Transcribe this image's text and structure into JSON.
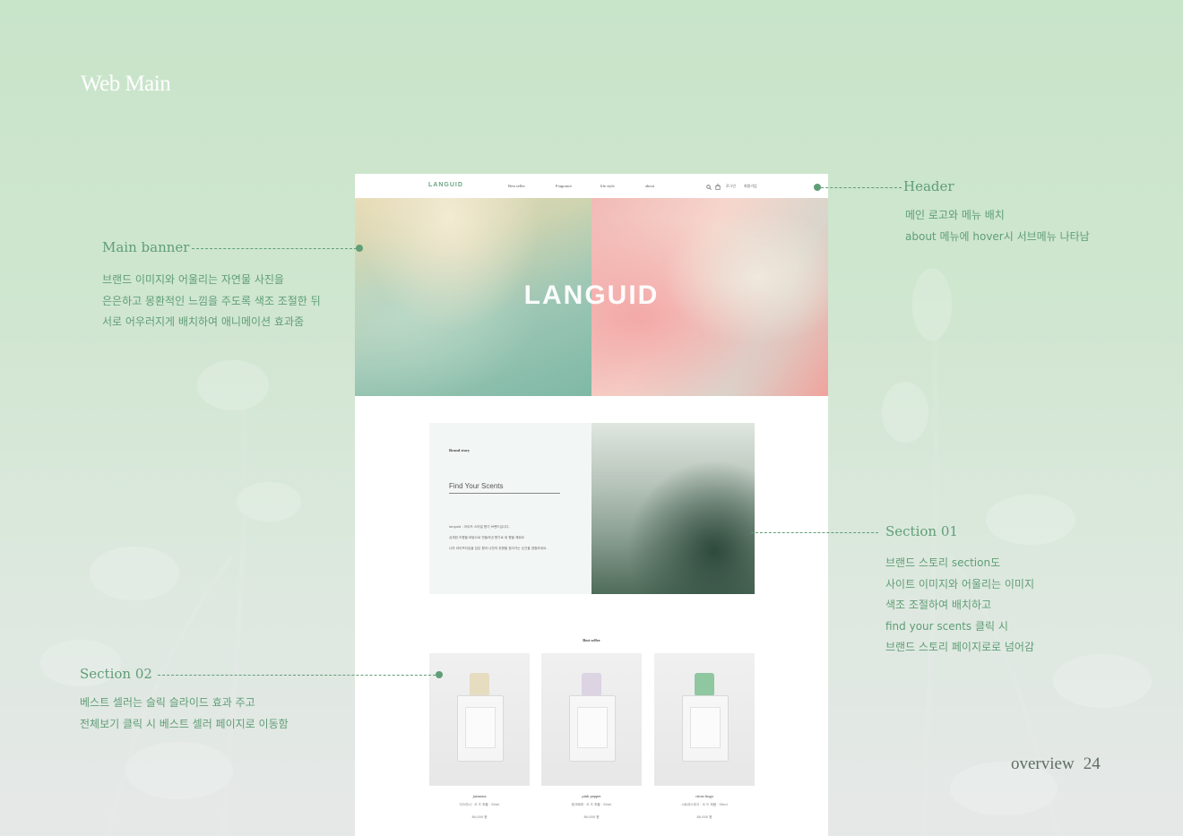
{
  "page": {
    "title": "Web Main",
    "footer_label": "overview",
    "footer_page": "24"
  },
  "annotations": {
    "header": {
      "title": "Header",
      "lines": [
        "메인 로고와 메뉴 배치",
        "about 메뉴에 hover시 서브메뉴 나타남"
      ]
    },
    "main_banner": {
      "title": "Main banner",
      "lines": [
        "브랜드 이미지와 어울리는 자연물 사진을",
        "은은하고 몽환적인 느낌을 주도록 색조 조절한 뒤",
        "서로 어우러지게 배치하여 애니메이션 효과줌"
      ]
    },
    "section01": {
      "title": "Section 01",
      "lines": [
        "브랜드 스토리 section도",
        "사이트 이미지와 어울리는 이미지",
        "색조 조절하여 배치하고",
        " find your scents 클릭 시",
        "브랜드 스토리 페이지로로 넘어감"
      ]
    },
    "section02": {
      "title": "Section 02",
      "lines": [
        "베스트 셀러는 슬릭 슬라이드 효과 주고",
        "전체보기 클릭 시 베스트 셀러 페이지로 이동함"
      ]
    }
  },
  "mock": {
    "header": {
      "logo": "LANGUID",
      "nav": [
        "Best seller",
        "Fragrance",
        "life style",
        "about"
      ],
      "util": [
        "로그인",
        "회원가입"
      ]
    },
    "banner": {
      "brand": "LANGUID"
    },
    "story": {
      "label": "Brand story",
      "cta": "Find Your Scents",
      "copy": [
        "languid : 아이즈 스타일 향기 브랜드입니다.",
        "섬세한 조향을 바탕으로 만들어낸 향기로 위 향을 채워요",
        "나의 라이프타입을 담은 향과 나만의 취향을 찾아가는 순간을 경험하세요."
      ]
    },
    "bestseller": {
      "title": "Best seller",
      "products": [
        {
          "name": "jasmona",
          "sub": "자스미나 · 오 드 퍼퓸 · 50ml",
          "price": "80,000 원",
          "cap_color": "#e6dcc0"
        },
        {
          "name": "pink pepper",
          "sub": "핑크페퍼 · 오 드 퍼퓸 · 50ml",
          "price": "80,000 원",
          "cap_color": "#dcd3e3"
        },
        {
          "name": "citrus bugo",
          "sub": "시트러스부고 · 오 드 퍼퓸 · 50ml",
          "price": "80,000 원",
          "cap_color": "#8fc7a0"
        }
      ]
    }
  }
}
